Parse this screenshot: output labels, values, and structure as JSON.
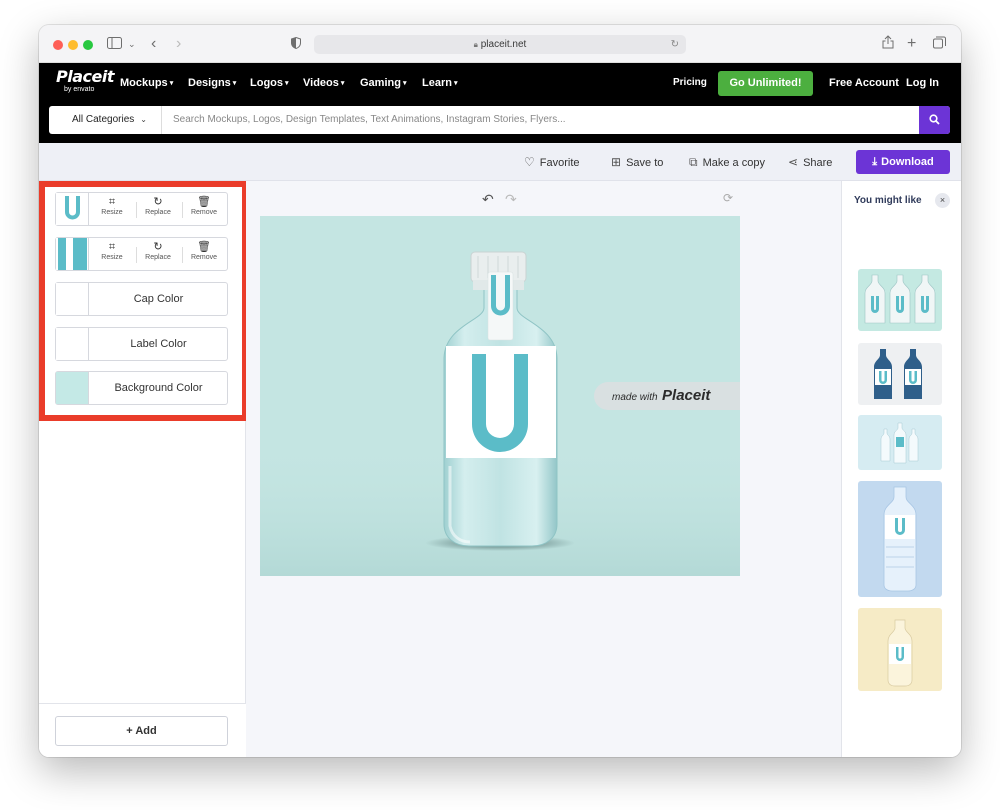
{
  "browser": {
    "url": "placeit.net"
  },
  "nav": {
    "logo_main": "Placeit",
    "logo_sub": "by envato",
    "items": [
      {
        "label": "Mockups"
      },
      {
        "label": "Designs"
      },
      {
        "label": "Logos"
      },
      {
        "label": "Videos"
      },
      {
        "label": "Gaming"
      },
      {
        "label": "Learn"
      }
    ],
    "pricing": "Pricing",
    "go_unlimited": "Go Unlimited!",
    "free_account": "Free Account",
    "log_in": "Log In"
  },
  "search": {
    "category": "All Categories",
    "placeholder": "Search Mockups, Logos, Design Templates, Text Animations, Instagram Stories, Flyers..."
  },
  "actions": {
    "favorite": "Favorite",
    "save_to": "Save to",
    "make_copy": "Make a copy",
    "share": "Share",
    "download": "Download"
  },
  "editor": {
    "image_layers": [
      {
        "tools": {
          "resize": "Resize",
          "replace": "Replace",
          "remove": "Remove"
        }
      },
      {
        "tools": {
          "resize": "Resize",
          "replace": "Replace",
          "remove": "Remove"
        }
      }
    ],
    "color_controls": [
      {
        "label": "Cap Color",
        "swatch": "#ffffff"
      },
      {
        "label": "Label Color",
        "swatch": "#ffffff"
      },
      {
        "label": "Background Color",
        "swatch": "#c4e9e6"
      }
    ],
    "add_label": "+ Add"
  },
  "canvas": {
    "watermark_prefix": "made with",
    "watermark_brand": "Placeit",
    "letter": "U",
    "background": "#c4e5e2"
  },
  "suggestions": {
    "title": "You might like",
    "close": "×"
  },
  "colors": {
    "accent_purple": "#6c34d6",
    "cta_green": "#4caf3f",
    "highlight_red": "#ea3c2a",
    "logo_teal": "#5bbcc8"
  }
}
